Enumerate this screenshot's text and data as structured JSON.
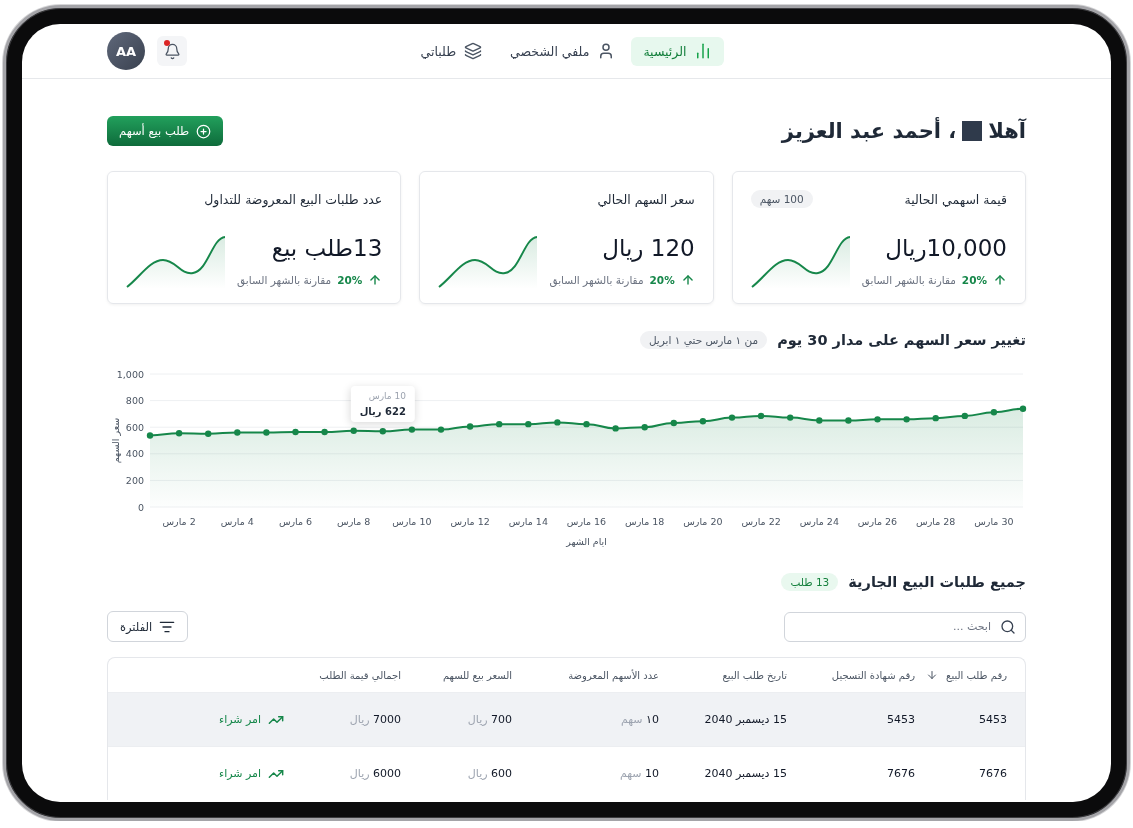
{
  "header": {
    "nav": [
      {
        "label": "الرئيسية",
        "kind": "home",
        "selected": true
      },
      {
        "label": "ملفي الشخصي",
        "kind": "profile",
        "selected": false
      },
      {
        "label": "طلباتي",
        "kind": "orders",
        "selected": false
      }
    ],
    "notifications": {
      "unread": true
    },
    "avatar": {
      "initials": "AA"
    }
  },
  "greeting": {
    "salutation": "آهلا",
    "name": "، أحمد عبد العزيز"
  },
  "new_request_button": "طلب بيع أسهم",
  "stats": [
    {
      "title": "قيمة اسهمي الحالية",
      "badge": "100 سهم",
      "value": "10,000ريال",
      "change": "20%",
      "comparison": "مقارنة بالشهر السابق"
    },
    {
      "title": "سعر السهم الحالي",
      "value": "120 ريال",
      "change": "20%",
      "comparison": "مقارنة بالشهر السابق"
    },
    {
      "title": "عدد طلبات البيع المعروضة للتداول",
      "value": "13طلب بيع",
      "change": "20%",
      "comparison": "مقارنة بالشهر السابق"
    }
  ],
  "price_chart": {
    "title": "تغيير سعر السهم على مدار 30 يوم",
    "period": "من ١ مارس حتي ١ ابريل",
    "tooltip": {
      "date": "10 مارس",
      "value": "622 ريال"
    },
    "chart_data": {
      "type": "area",
      "xlabel": "ايام الشهر",
      "ylabel": "سعر السهم",
      "x": [
        1,
        2,
        3,
        4,
        5,
        6,
        7,
        8,
        9,
        10,
        11,
        12,
        13,
        14,
        15,
        16,
        17,
        18,
        19,
        20,
        21,
        22,
        23,
        24,
        25,
        26,
        27,
        28,
        29,
        30,
        31
      ],
      "series": [
        {
          "color": "#16874a",
          "marker": "circle",
          "values": [
            538,
            555,
            551,
            560,
            560,
            564,
            564,
            573,
            569,
            582,
            582,
            605,
            623,
            623,
            636,
            623,
            591,
            600,
            632,
            645,
            672,
            685,
            672,
            650,
            650,
            659,
            659,
            668,
            685,
            712,
            739
          ]
        }
      ],
      "xlim": [
        1,
        31
      ],
      "ylim": [
        0,
        1000
      ],
      "xticks": [
        {
          "value": 2,
          "label": "2 مارس"
        },
        {
          "value": 4,
          "label": "4 مارس"
        },
        {
          "value": 6,
          "label": "6 مارس"
        },
        {
          "value": 8,
          "label": "8 مارس"
        },
        {
          "value": 10,
          "label": "10 مارس"
        },
        {
          "value": 12,
          "label": "12 مارس"
        },
        {
          "value": 14,
          "label": "14 مارس"
        },
        {
          "value": 16,
          "label": "16 مارس"
        },
        {
          "value": 18,
          "label": "18 مارس"
        },
        {
          "value": 20,
          "label": "20 مارس"
        },
        {
          "value": 22,
          "label": "22 مارس"
        },
        {
          "value": 24,
          "label": "24 مارس"
        },
        {
          "value": 26,
          "label": "26 مارس"
        },
        {
          "value": 28,
          "label": "28 مارس"
        },
        {
          "value": 30,
          "label": "30 مارس"
        }
      ],
      "yticks": [
        0,
        200,
        400,
        600,
        800,
        {
          "value": 1000,
          "label": "1,000"
        }
      ],
      "grid": true
    }
  },
  "requests": {
    "title": "جميع طلبات البيع الجارية",
    "count": "13 طلب",
    "search": {
      "placeholder": "ابحث ..."
    },
    "filter_button": "الفلترة",
    "table": {
      "columns": [
        {
          "label": "رقم طلب البيع",
          "sorted": true
        },
        {
          "label": "رقم شهادة التسجيل",
          "sorted": false
        },
        {
          "label": "تاريخ طلب البيع",
          "sorted": false
        },
        {
          "label": "عدد الأسهم المعروضة",
          "sorted": false
        },
        {
          "label": "السعر بيع للسهم",
          "sorted": false
        },
        {
          "label": "اجمالي قيمة الطلب",
          "sorted": false
        }
      ],
      "rows": [
        {
          "order_no": "5453",
          "certificate_no": "5453",
          "date": "15 ديسمبر 2040",
          "shares": {
            "amount": "١0",
            "unit": "سهم"
          },
          "price": {
            "amount": "700",
            "unit": "ريال"
          },
          "total": {
            "amount": "7000",
            "unit": "ريال"
          },
          "action": "امر شراء",
          "highlighted": true
        },
        {
          "order_no": "7676",
          "certificate_no": "7676",
          "date": "15 ديسمبر 2040",
          "shares": {
            "amount": "10",
            "unit": "سهم"
          },
          "price": {
            "amount": "600",
            "unit": "ريال"
          },
          "total": {
            "amount": "6000",
            "unit": "ريال"
          },
          "action": "امر شراء",
          "highlighted": false
        }
      ]
    }
  }
}
